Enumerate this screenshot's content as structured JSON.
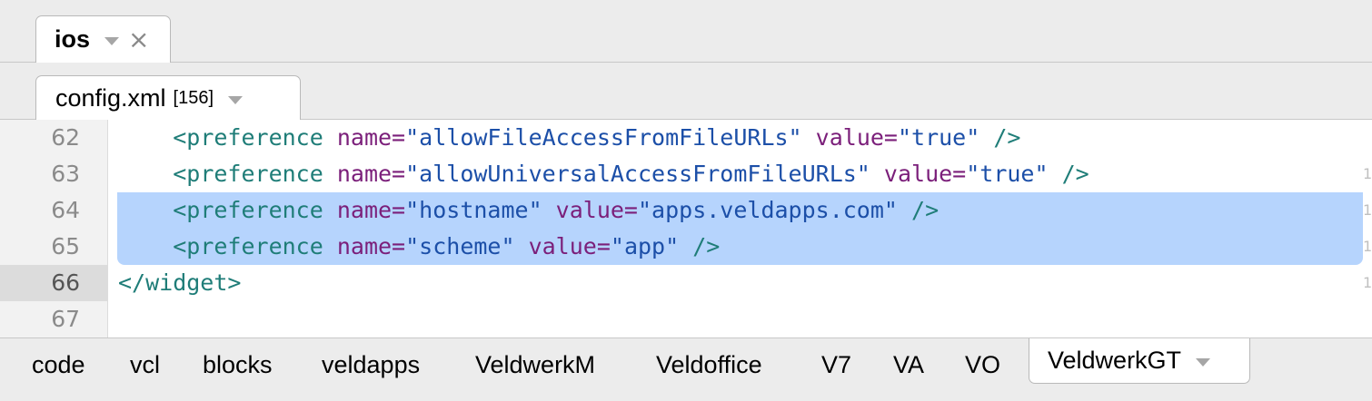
{
  "group_tab": {
    "label": "ios"
  },
  "file_tab": {
    "label": "config.xml",
    "count": "[156]"
  },
  "editor": {
    "lines": [
      {
        "num": "62",
        "indent": "    ",
        "tag": "<preference",
        "attr1": " name=",
        "val1": "\"allowFileAccessFromFileURLs\"",
        "attr2": " value=",
        "val2": "\"true\"",
        "close": " />"
      },
      {
        "num": "63",
        "indent": "    ",
        "tag": "<preference",
        "attr1": " name=",
        "val1": "\"allowUniversalAccessFromFileURLs\"",
        "attr2": " value=",
        "val2": "\"true\"",
        "close": " />"
      },
      {
        "num": "64",
        "indent": "    ",
        "tag": "<preference",
        "attr1": " name=",
        "val1": "\"hostname\"",
        "attr2": " value=",
        "val2": "\"apps.veldapps.com\"",
        "close": " />"
      },
      {
        "num": "65",
        "indent": "    ",
        "tag": "<preference",
        "attr1": " name=",
        "val1": "\"scheme\"",
        "attr2": " value=",
        "val2": "\"app\"",
        "close": " />"
      },
      {
        "num": "66",
        "closing_tag": "</widget>"
      },
      {
        "num": "67"
      }
    ],
    "right_marks": [
      "1",
      "1",
      "1",
      "1"
    ]
  },
  "projects": {
    "items": [
      "code",
      "vcl",
      "blocks",
      "veldapps",
      "VeldwerkM",
      "Veldoffice",
      "V7",
      "VA",
      "VO"
    ],
    "active": "VeldwerkGT"
  },
  "colors": {
    "tag": "#1f7d78",
    "attribute": "#7b1f7a",
    "string": "#1c4fa8",
    "selection": "#b6d4fd"
  }
}
